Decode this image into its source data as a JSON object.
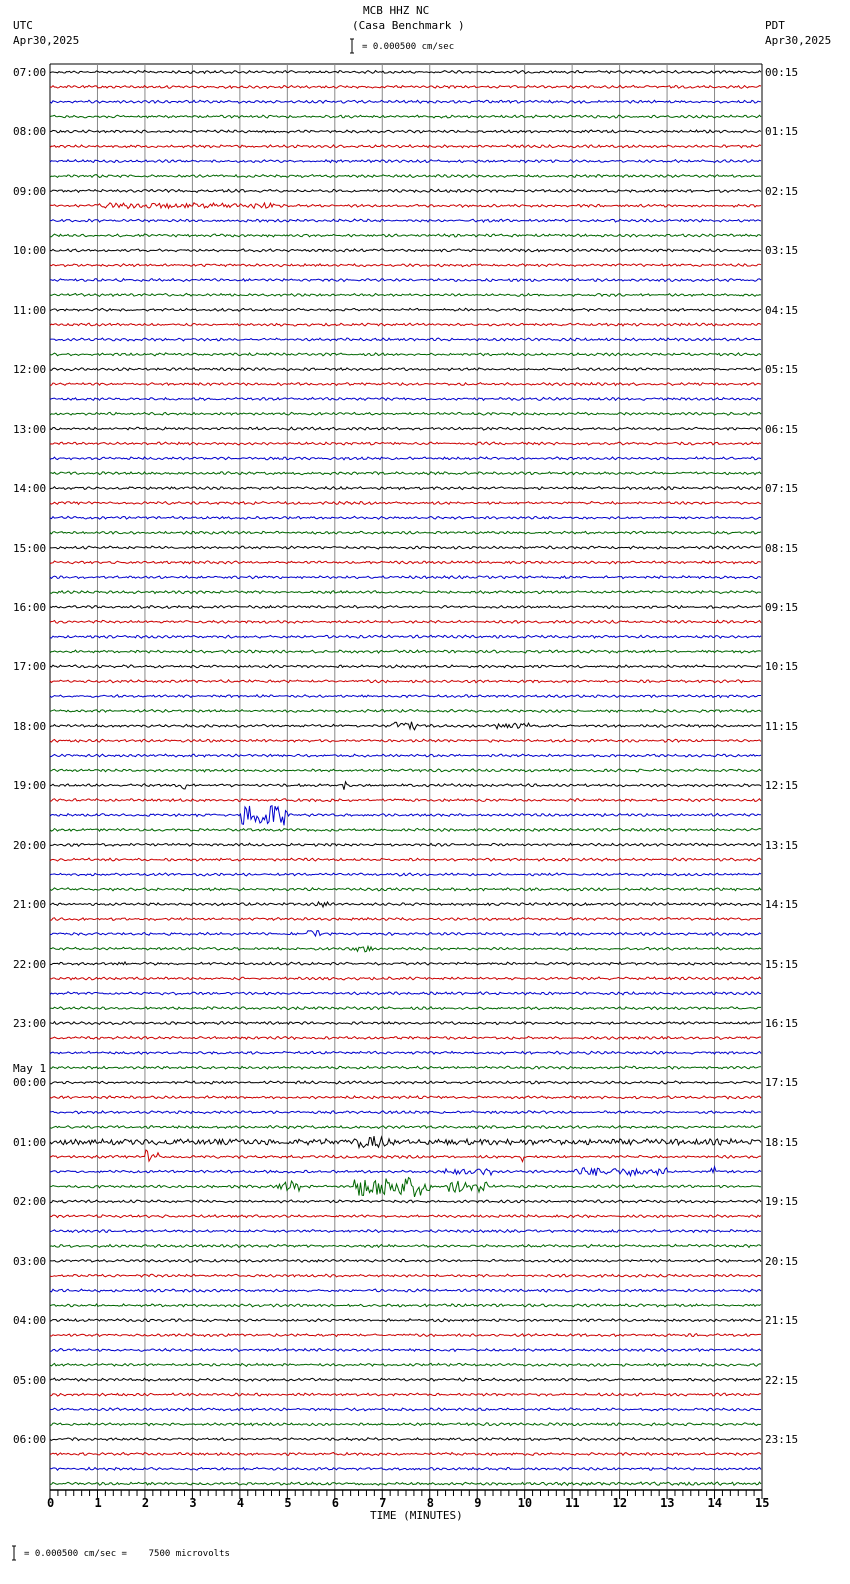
{
  "header": {
    "station": "MCB HHZ NC",
    "location": "(Casa Benchmark )",
    "left_tz": "UTC",
    "left_date": "Apr30,2025",
    "right_tz": "PDT",
    "right_date": "Apr30,2025",
    "scale": "= 0.000500 cm/sec"
  },
  "footer": {
    "scale_note": "= 0.000500 cm/sec =    7500 microvolts"
  },
  "chart_data": {
    "type": "line",
    "title": "MCB HHZ NC (Casa Benchmark )",
    "xlabel": "TIME (MINUTES)",
    "xlim": [
      0,
      15
    ],
    "x_ticks": [
      "0",
      "1",
      "2",
      "3",
      "4",
      "5",
      "6",
      "7",
      "8",
      "9",
      "10",
      "11",
      "12",
      "13",
      "14",
      "15"
    ],
    "grid": true,
    "traces_per_hour": 4,
    "trace_minutes": 15,
    "trace_colors": [
      "#000000",
      "#cc0000",
      "#0000cc",
      "#006600"
    ],
    "left_labels": [
      "07:00",
      "08:00",
      "09:00",
      "10:00",
      "11:00",
      "12:00",
      "13:00",
      "14:00",
      "15:00",
      "16:00",
      "17:00",
      "18:00",
      "19:00",
      "20:00",
      "21:00",
      "22:00",
      "23:00",
      "00:00",
      "01:00",
      "02:00",
      "03:00",
      "04:00",
      "05:00",
      "06:00"
    ],
    "left_date_change": "May 1",
    "right_labels": [
      "00:15",
      "01:15",
      "02:15",
      "03:15",
      "04:15",
      "05:15",
      "06:15",
      "07:15",
      "08:15",
      "09:15",
      "10:15",
      "11:15",
      "12:15",
      "13:15",
      "14:15",
      "15:15",
      "16:15",
      "17:15",
      "18:15",
      "19:15",
      "20:15",
      "21:15",
      "22:15",
      "23:15"
    ],
    "events": [
      {
        "trace": 9,
        "start": 1.0,
        "end": 4.8,
        "amp": 2.5
      },
      {
        "trace": 44,
        "start": 7.2,
        "end": 7.7,
        "amp": 4
      },
      {
        "trace": 44,
        "start": 8.2,
        "end": 8.3,
        "amp": 6
      },
      {
        "trace": 44,
        "start": 9.4,
        "end": 10.1,
        "amp": 2.5
      },
      {
        "trace": 48,
        "start": 2.78,
        "end": 2.85,
        "amp": 6
      },
      {
        "trace": 48,
        "start": 6.15,
        "end": 6.25,
        "amp": 5
      },
      {
        "trace": 50,
        "start": 4.0,
        "end": 5.0,
        "amp": 11
      },
      {
        "trace": 56,
        "start": 5.5,
        "end": 5.9,
        "amp": 2.5
      },
      {
        "trace": 58,
        "start": 5.4,
        "end": 5.7,
        "amp": 5
      },
      {
        "trace": 59,
        "start": 6.4,
        "end": 6.8,
        "amp": 3
      },
      {
        "trace": 60,
        "start": 1.4,
        "end": 1.6,
        "amp": 3
      },
      {
        "trace": 72,
        "start": 0.0,
        "end": 15.0,
        "amp": 2.5
      },
      {
        "trace": 72,
        "start": 6.5,
        "end": 7.1,
        "amp": 6
      },
      {
        "trace": 73,
        "start": 2.0,
        "end": 2.3,
        "amp": 8
      },
      {
        "trace": 73,
        "start": 9.9,
        "end": 10.0,
        "amp": 7
      },
      {
        "trace": 74,
        "start": 8.3,
        "end": 9.3,
        "amp": 3
      },
      {
        "trace": 74,
        "start": 11.0,
        "end": 13.0,
        "amp": 4
      },
      {
        "trace": 74,
        "start": 13.9,
        "end": 14.0,
        "amp": 6
      },
      {
        "trace": 75,
        "start": 4.8,
        "end": 5.3,
        "amp": 5
      },
      {
        "trace": 75,
        "start": 6.4,
        "end": 8.0,
        "amp": 10
      },
      {
        "trace": 75,
        "start": 8.4,
        "end": 9.2,
        "amp": 6
      },
      {
        "trace": 95,
        "start": 10.0,
        "end": 15.0,
        "amp": 1.2
      }
    ]
  }
}
